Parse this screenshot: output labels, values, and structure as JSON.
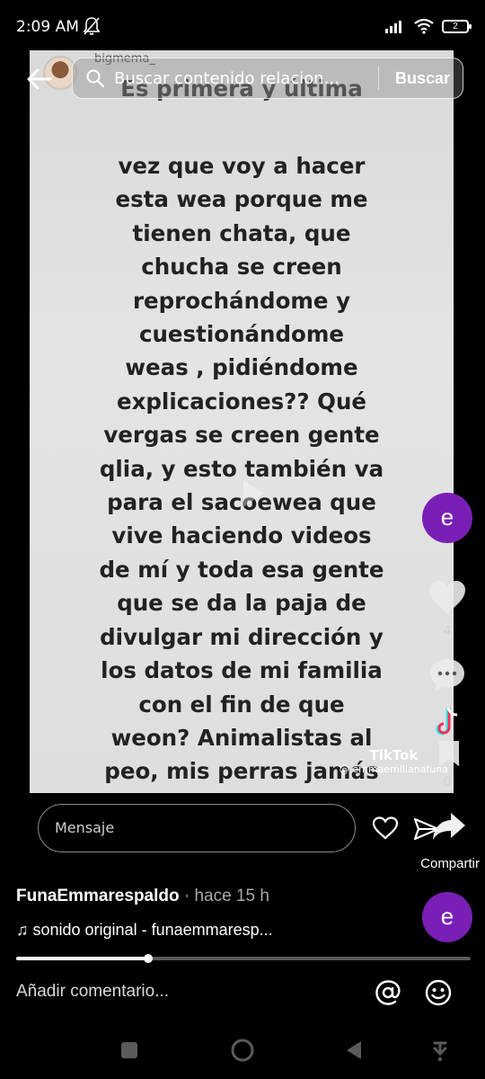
{
  "status_bar": {
    "time": "2:09 AM",
    "battery_level": "2",
    "icons": [
      "bell-off-icon",
      "signal-icon",
      "wifi-icon",
      "battery-icon"
    ]
  },
  "search": {
    "placeholder": "Buscar contenido relacion...",
    "button_label": "Buscar"
  },
  "video": {
    "username": "bigmema_",
    "top_line": "Es primera y última",
    "text": "vez que voy a hacer\nesta wea porque me\ntienen chata, que\nchucha se creen\nreprochándome y\ncuestionándome\nweas , pidiéndome\nexplicaciones?? Qué\nvergas se creen gente\nqlia, y esto también va\npara el sacoewea que\nvive haciendo videos\nde mí y toda esa gente\nque se da la paja de\ndivulgar mi dirección y\nlos datos de mi familia\ncon el fin de que\nweon? Animalistas al\npeo, mis perras jamás\nhan estado mal",
    "watermark_brand": "TikTok",
    "watermark_handle": "@ emmaemilianafuna"
  },
  "rail": {
    "profile_initial": "e",
    "like_count": "4",
    "bookmark_count": "0"
  },
  "message": {
    "placeholder": "Mensaje"
  },
  "share_label": "Compartir",
  "post": {
    "author": "FunaEmmarespaldo",
    "time": " · hace 15 h",
    "sound": "♫ sonido original - funaemmaresp...",
    "author_initial": "e",
    "progress": 0.29
  },
  "comment": {
    "placeholder": "Añadir comentario..."
  },
  "colors": {
    "avatar_purple": "#7a1fb5",
    "background": "#000000"
  }
}
